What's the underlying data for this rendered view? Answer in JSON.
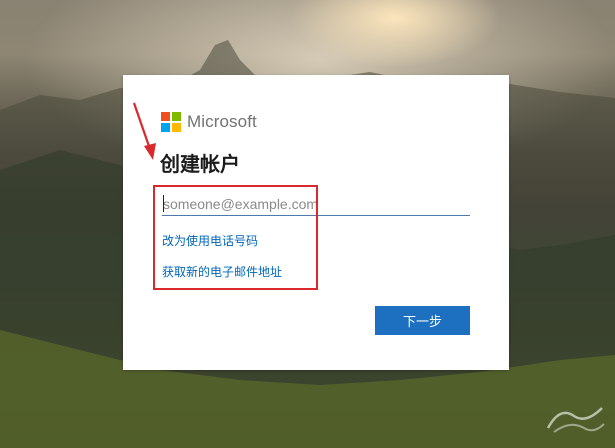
{
  "brand": {
    "name": "Microsoft",
    "logo_colors": [
      "#f25022",
      "#7fba00",
      "#00a4ef",
      "#ffb900"
    ]
  },
  "dialog": {
    "title": "创建帐户",
    "email_placeholder": "someone@example.com",
    "email_value": "",
    "link_phone": "改为使用电话号码",
    "link_new_email": "获取新的电子邮件地址",
    "next_label": "下一步"
  },
  "colors": {
    "accent": "#1d6fc0",
    "link": "#0067b8",
    "annotation": "#d9292c"
  }
}
